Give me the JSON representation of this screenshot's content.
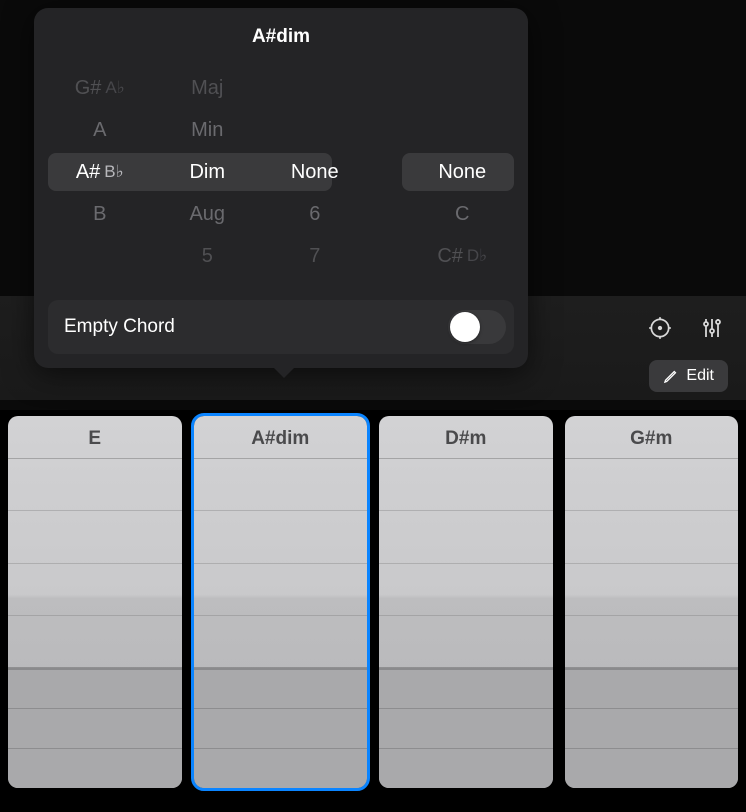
{
  "popover": {
    "title": "A#dim",
    "root_wheel": [
      {
        "main": "G#",
        "enh": "A♭",
        "dist": "far"
      },
      {
        "main": "A",
        "enh": "",
        "dist": "near"
      },
      {
        "main": "A#",
        "enh": "B♭",
        "dist": "center"
      },
      {
        "main": "B",
        "enh": "",
        "dist": "near"
      },
      {
        "main": "",
        "enh": "",
        "dist": "far"
      }
    ],
    "quality_wheel": [
      {
        "main": "Maj",
        "dist": "far"
      },
      {
        "main": "Min",
        "dist": "near"
      },
      {
        "main": "Dim",
        "dist": "center"
      },
      {
        "main": "Aug",
        "dist": "near"
      },
      {
        "main": "5",
        "dist": "far"
      }
    ],
    "ext_wheel": [
      {
        "main": "",
        "dist": "far"
      },
      {
        "main": "",
        "dist": "near"
      },
      {
        "main": "None",
        "dist": "center"
      },
      {
        "main": "6",
        "dist": "near"
      },
      {
        "main": "7",
        "dist": "far"
      }
    ],
    "bass_wheel": [
      {
        "main": "",
        "enh": "",
        "dist": "far"
      },
      {
        "main": "",
        "enh": "",
        "dist": "near"
      },
      {
        "main": "None",
        "enh": "",
        "dist": "center"
      },
      {
        "main": "C",
        "enh": "",
        "dist": "near"
      },
      {
        "main": "C#",
        "enh": "D♭",
        "dist": "far"
      }
    ],
    "empty_chord_label": "Empty Chord",
    "empty_chord_on": false
  },
  "toolbar": {
    "edit_label": "Edit"
  },
  "chords": [
    {
      "name": "E",
      "selected": false
    },
    {
      "name": "A#dim",
      "selected": true
    },
    {
      "name": "D#m",
      "selected": false
    },
    {
      "name": "G#m",
      "selected": false
    }
  ]
}
